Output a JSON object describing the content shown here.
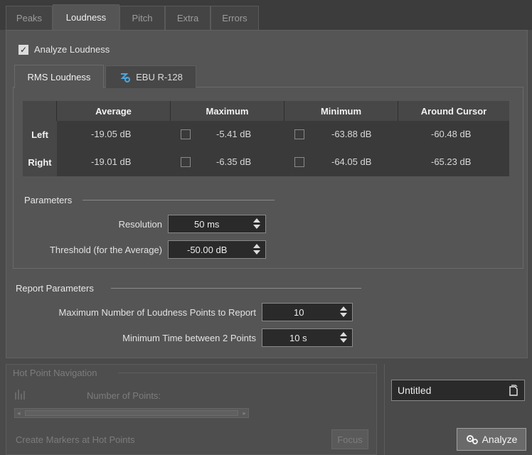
{
  "tabs": [
    {
      "label": "Peaks",
      "active": false
    },
    {
      "label": "Loudness",
      "active": true
    },
    {
      "label": "Pitch",
      "active": false
    },
    {
      "label": "Extra",
      "active": false
    },
    {
      "label": "Errors",
      "active": false
    }
  ],
  "analyze_loudness": {
    "label": "Analyze Loudness",
    "checked": true
  },
  "inner_tabs": [
    {
      "label": "RMS Loudness",
      "active": true
    },
    {
      "label": "EBU R-128",
      "active": false
    }
  ],
  "table": {
    "headers": [
      "Average",
      "Maximum",
      "Minimum",
      "Around Cursor"
    ],
    "rows": [
      {
        "label": "Left",
        "average": "-19.05 dB",
        "maximum": "-5.41 dB",
        "minimum": "-63.88 dB",
        "around_cursor": "-60.48 dB"
      },
      {
        "label": "Right",
        "average": "-19.01 dB",
        "maximum": "-6.35 dB",
        "minimum": "-64.05 dB",
        "around_cursor": "-65.23 dB"
      }
    ]
  },
  "parameters": {
    "title": "Parameters",
    "resolution_label": "Resolution",
    "resolution_value": "50 ms",
    "threshold_label": "Threshold (for the Average)",
    "threshold_value": "-50.00 dB"
  },
  "report_parameters": {
    "title": "Report Parameters",
    "max_points_label": "Maximum Number of Loudness Points to Report",
    "max_points_value": "10",
    "min_time_label": "Minimum Time between 2 Points",
    "min_time_value": "10 s"
  },
  "hot_point_navigation": {
    "title": "Hot Point Navigation",
    "number_of_points_label": "Number of Points:",
    "create_markers_label": "Create Markers at Hot Points",
    "focus_label": "Focus"
  },
  "preset": {
    "name": "Untitled"
  },
  "analyze_button": {
    "label": "Analyze"
  },
  "colors": {
    "background": "#4a4a4a",
    "panel": "#555555",
    "accent_icon": "#4aa8e0"
  }
}
